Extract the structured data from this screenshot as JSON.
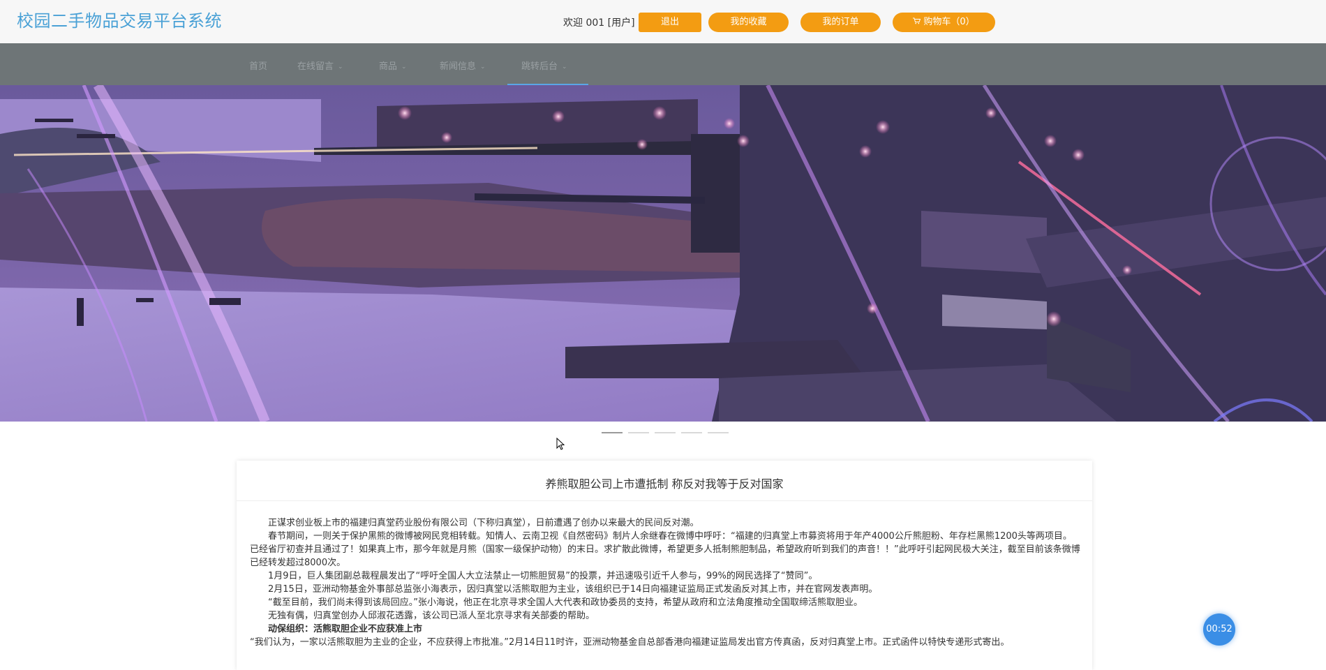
{
  "header": {
    "site_title": "校园二手物品交易平台系统",
    "welcome": "欢迎 001 [用户]",
    "logout_label": "退出",
    "favorites_label": "我的收藏",
    "orders_label": "我的订单",
    "cart_label": "购物车（0）",
    "cart_icon": "shopping-cart-icon"
  },
  "nav": {
    "items": [
      {
        "label": "首页",
        "has_dropdown": false
      },
      {
        "label": "在线留言",
        "has_dropdown": true
      },
      {
        "label": "商品",
        "has_dropdown": true
      },
      {
        "label": "新闻信息",
        "has_dropdown": true
      },
      {
        "label": "跳转后台",
        "has_dropdown": true
      }
    ]
  },
  "carousel": {
    "slide_count": 5,
    "active_index": 0
  },
  "article": {
    "title": "养熊取胆公司上市遭抵制 称反对我等于反对国家",
    "paragraphs": [
      "正谋求创业板上市的福建归真堂药业股份有限公司（下称归真堂），日前遭遇了创办以来最大的民间反对潮。",
      "春节期间，一则关于保护黑熊的微博被网民竞相转载。知情人、云南卫视《自然密码》制片人余继春在微博中呼吁：“福建的归真堂上市募资将用于年产4000公斤熊胆粉、年存栏黑熊1200头等两项目。已经省厅初查并且通过了！如果真上市，那今年就是月熊（国家一级保护动物）的末日。求扩散此微博，希望更多人抵制熊胆制品，希望政府听到我们的声音！！”此呼吁引起网民极大关注，截至目前该条微博已经转发超过8000次。",
      "1月9日，巨人集团副总裁程晨发出了“呼吁全国人大立法禁止一切熊胆贸易”的投票，并迅速吸引近千人参与，99%的网民选择了“赞同”。",
      "2月15日，亚洲动物基金外事部总监张小海表示，因归真堂以活熊取胆为主业，该组织已于14日向福建证监局正式发函反对其上市，并在官网发表声明。",
      "“截至目前，我们尚未得到该局回应。”张小海说，他正在北京寻求全国人大代表和政协委员的支持，希望从政府和立法角度推动全国取缔活熊取胆业。",
      "无独有偶，归真堂创办人邱淑花透露，该公司已派人至北京寻求有关部委的帮助。",
      "动保组织：活熊取胆企业不应获准上市",
      "“我们认为，一家以活熊取胆为主业的企业，不应获得上市批准。”2月14日11时许，亚洲动物基金自总部香港向福建证监局发出官方传真函，反对归真堂上市。正式函件以特快专递形式寄出。"
    ]
  },
  "timer": {
    "text": "00:52"
  }
}
